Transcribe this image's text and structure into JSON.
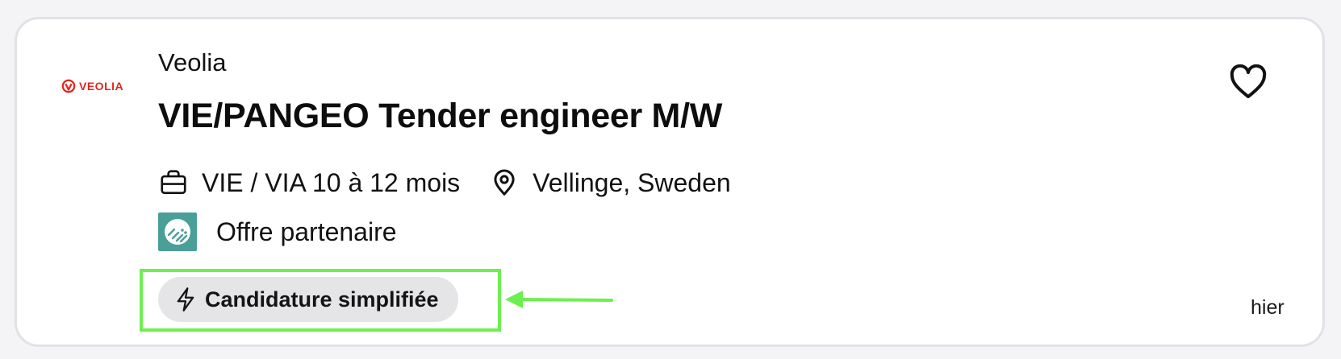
{
  "card": {
    "logo_text": "VEOLIA",
    "company": "Veolia",
    "title": "VIE/PANGEO Tender engineer M/W",
    "contract": "VIE / VIA 10 à 12 mois",
    "location": "Vellinge, Sweden",
    "partner_label": "Offre partenaire",
    "badge_label": "Candidature simplifiée",
    "date": "hier"
  },
  "colors": {
    "brand_red": "#e2261c",
    "highlight_green": "#6cf04f",
    "partner_teal": "#4a9f98",
    "badge_bg": "#e5e5e8"
  },
  "icons": {
    "contract": "briefcase-icon",
    "location": "location-pin-icon",
    "badge": "lightning-icon",
    "favorite": "heart-icon"
  }
}
